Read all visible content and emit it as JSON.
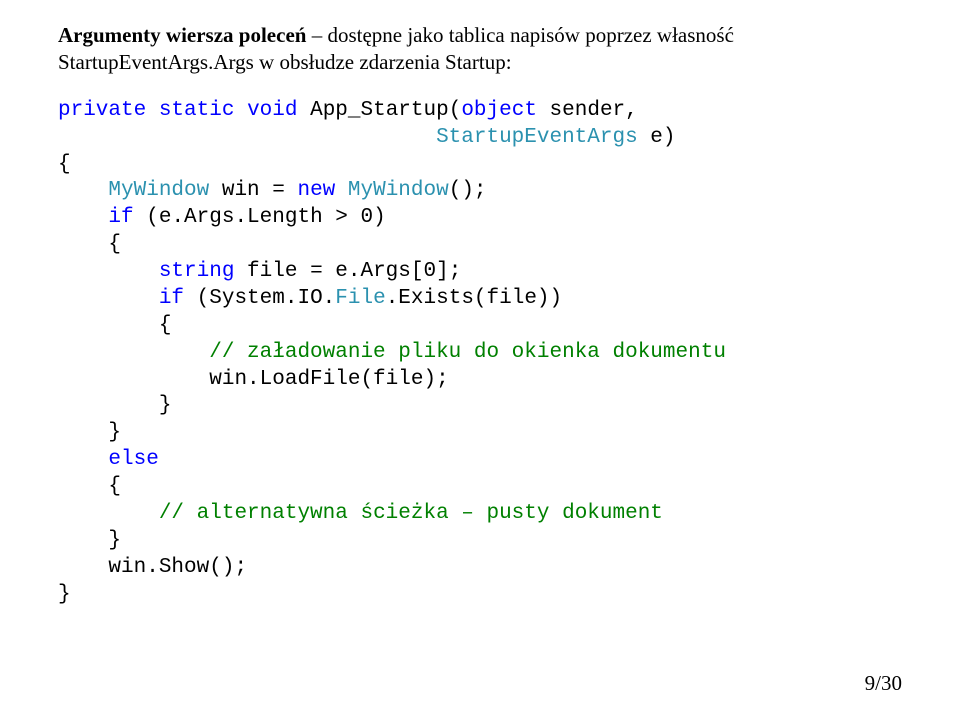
{
  "intro": {
    "line1_prefix_bold": "Argumenty wiersza poleceń",
    "line1_rest": " – dostępne jako tablica napisów poprzez własność ",
    "line2": "StartupEventArgs.Args w obsłudze zdarzenia Startup:"
  },
  "code": {
    "t_private": "private",
    "t_static": "static",
    "t_void": "void",
    "t_method": " App_Startup(",
    "t_object": "object",
    "t_sender": " sender,",
    "t_seArgs": "StartupEventArgs",
    "t_e": " e)",
    "t_open1": "{",
    "t_mywin_type": "MyWindow",
    "t_mywin_decl": " win = ",
    "t_new": "new",
    "t_mywin_ctor": " ",
    "t_mywin_type2": "MyWindow",
    "t_mywin_call": "();",
    "t_if": "if",
    "t_if_cond": " (e.Args.Length > 0)",
    "t_open2": "{",
    "t_string": "string",
    "t_file_decl": " file = e.Args[0];",
    "t_if2": "if",
    "t_if2_cond": " (System.IO.",
    "t_File": "File",
    "t_exists": ".Exists(file))",
    "t_open3": "{",
    "t_cmt1": "// załadowanie pliku do okienka dokumentu",
    "t_loadfile": "win.LoadFile(file);",
    "t_close3": "}",
    "t_close2": "}",
    "t_else": "else",
    "t_open4": "{",
    "t_cmt2": "// alternatywna ścieżka – pusty dokument",
    "t_close4": "}",
    "t_show": "win.Show();",
    "t_close1": "}"
  },
  "pagenum": "9/30"
}
